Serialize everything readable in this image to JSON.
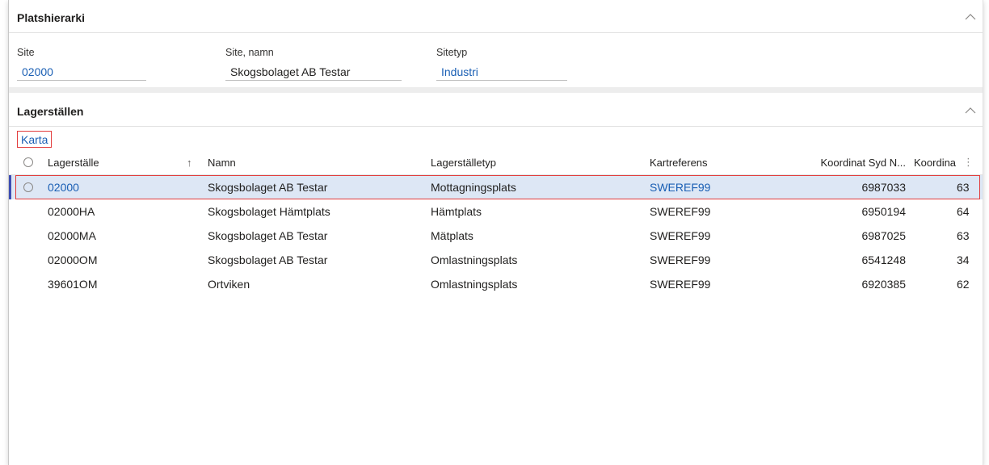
{
  "site_hierarchy": {
    "title": "Platshierarki",
    "collapse_glyph": "chevron-up-icon",
    "fields": {
      "site": {
        "label": "Site",
        "value": "02000"
      },
      "site_name": {
        "label": "Site, namn",
        "value": "Skogsbolaget AB Testar"
      },
      "site_type": {
        "label": "Sitetyp",
        "value": "Industri"
      }
    }
  },
  "warehouses": {
    "title": "Lagerställen",
    "map_button": "Karta",
    "columns": {
      "lagerstalle": "Lagerställe",
      "namn": "Namn",
      "typ": "Lagerställetyp",
      "kartreferens": "Kartreferens",
      "koord_syd": "Koordinat Syd N...",
      "koord": "Koordina"
    },
    "sort_glyph": "↑",
    "more_glyph": "⋮",
    "rows": [
      {
        "id": "02000",
        "namn": "Skogsbolaget AB Testar",
        "typ": "Mottagningsplats",
        "ref": "SWEREF99",
        "syd": "6987033",
        "koord": "63"
      },
      {
        "id": "02000HA",
        "namn": "Skogsbolaget Hämtplats",
        "typ": "Hämtplats",
        "ref": "SWEREF99",
        "syd": "6950194",
        "koord": "64"
      },
      {
        "id": "02000MA",
        "namn": "Skogsbolaget AB Testar",
        "typ": "Mätplats",
        "ref": "SWEREF99",
        "syd": "6987025",
        "koord": "63"
      },
      {
        "id": "02000OM",
        "namn": "Skogsbolaget AB Testar",
        "typ": "Omlastningsplats",
        "ref": "SWEREF99",
        "syd": "6541248",
        "koord": "34"
      },
      {
        "id": "39601OM",
        "namn": "Ortviken",
        "typ": "Omlastningsplats",
        "ref": "SWEREF99",
        "syd": "6920385",
        "koord": "62"
      }
    ]
  },
  "colors": {
    "link": "#1a5fb4",
    "selected_row": "#dde7f5",
    "highlight_border": "#e23c3c"
  }
}
